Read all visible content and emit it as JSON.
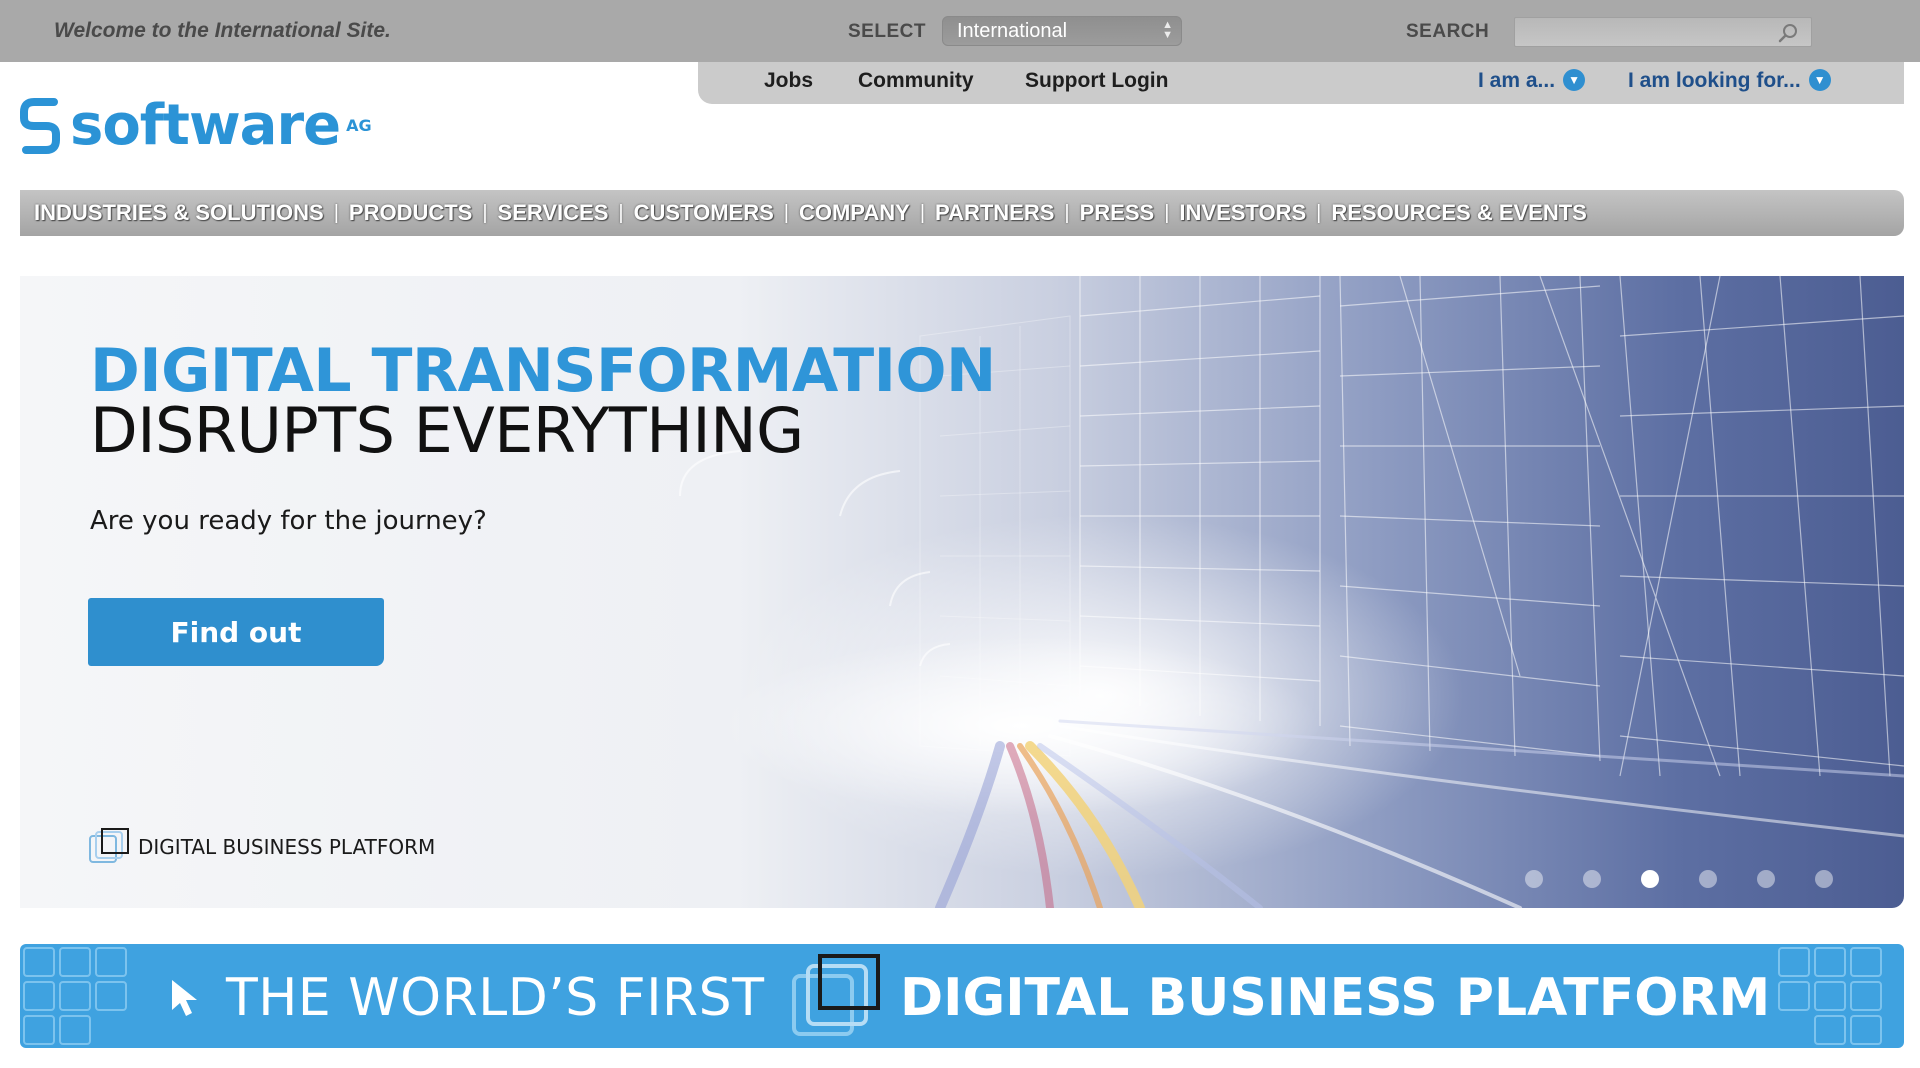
{
  "topbar": {
    "welcome": "Welcome to the International Site.",
    "select_label": "SELECT",
    "select_value": "International",
    "search_label": "SEARCH",
    "search_value": ""
  },
  "subnav": {
    "links": [
      "Jobs",
      "Community",
      "Support Login"
    ],
    "i_am": "I am a...",
    "looking_for": "I am looking for..."
  },
  "logo": {
    "text": "software",
    "suffix": "AG",
    "color": "#2b93d6"
  },
  "mainnav": {
    "items": [
      "INDUSTRIES & SOLUTIONS",
      "PRODUCTS",
      "SERVICES",
      "CUSTOMERS",
      "COMPANY",
      "PARTNERS",
      "PRESS",
      "INVESTORS",
      "RESOURCES & EVENTS"
    ]
  },
  "hero": {
    "title_line1": "DIGITAL TRANSFORMATION",
    "title_line2": "DISRUPTS EVERYTHING",
    "subtitle": "Are you ready for the journey?",
    "button": "Find out",
    "platform_tag": "DIGITAL BUSINESS PLATFORM",
    "slides_count": 6,
    "active_slide": 3,
    "accent_color": "#2f95d8"
  },
  "banner": {
    "text1": "THE WORLD’S FIRST",
    "text2": "DIGITAL BUSINESS PLATFORM",
    "color": "#3fa2e0"
  }
}
